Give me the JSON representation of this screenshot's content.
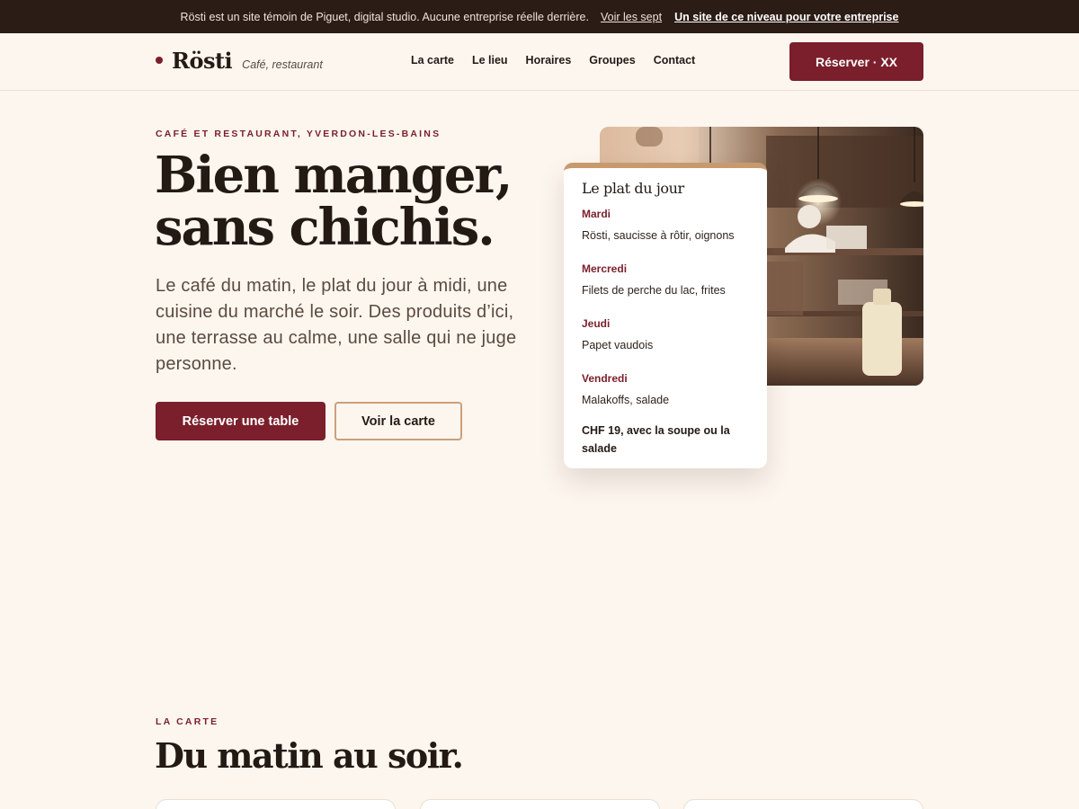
{
  "topbar": {
    "message": "Rösti est un site témoin de Piguet, digital studio. Aucune entreprise réelle derrière.",
    "link_seven": "Voir les sept",
    "link_strong": "Un site de ce niveau pour votre entreprise"
  },
  "header": {
    "brand": "Rösti",
    "tagline": "Café, restaurant",
    "nav": [
      "La carte",
      "Le lieu",
      "Horaires",
      "Groupes",
      "Contact"
    ],
    "cta": "Réserver · XX"
  },
  "hero": {
    "eyebrow": "CAFÉ ET RESTAURANT, YVERDON-LES-BAINS",
    "title_line1": "Bien manger,",
    "title_line2": "sans chichis.",
    "lead": "Le café du matin, le plat du jour à midi, une cuisine du marché le soir. Des produits d’ici, une terrasse au calme, une salle qui ne juge personne.",
    "btn_primary": "Réserver une table",
    "btn_secondary": "Voir la carte"
  },
  "plat_du_jour": {
    "title": "Le plat du jour",
    "days": [
      {
        "day": "Mardi",
        "dish": "Rösti, saucisse à rôtir, oignons"
      },
      {
        "day": "Mercredi",
        "dish": "Filets de perche du lac, frites"
      },
      {
        "day": "Jeudi",
        "dish": "Papet vaudois"
      },
      {
        "day": "Vendredi",
        "dish": "Malakoffs, salade"
      }
    ],
    "price": "CHF 19, avec la soupe ou la salade"
  },
  "carte": {
    "eyebrow": "LA CARTE",
    "title": "Du matin au soir."
  },
  "colors": {
    "accent": "#7a1f2b",
    "topbar_bg": "#2c1c16",
    "page_bg": "#fdf6ef",
    "card_border_top": "#c79a6e"
  }
}
